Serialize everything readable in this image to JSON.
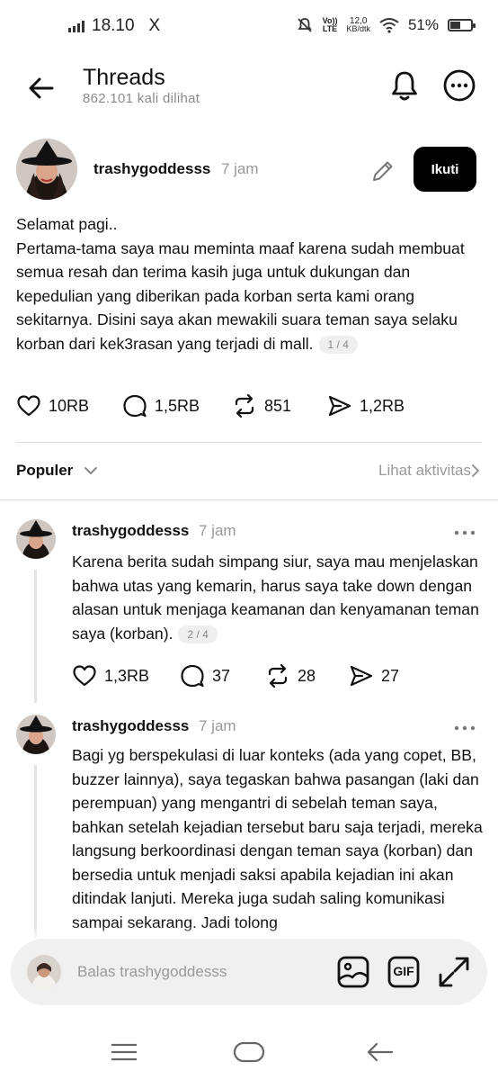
{
  "status_bar": {
    "time": "18.10",
    "x_icon": "X",
    "net_lte": "LTE",
    "net_speed_value": "12,0",
    "net_speed_unit": "KB/dtk",
    "battery": "51%",
    "battery_level": 0.51
  },
  "header": {
    "title": "Threads",
    "subtitle": "862.101 kali dilihat"
  },
  "post": {
    "username": "trashygoddesss",
    "time": "7 jam",
    "follow_label": "Ikuti",
    "text": "Selamat pagi..\nPertama-tama saya mau meminta maaf karena sudah membuat semua resah dan terima kasih juga untuk dukungan dan kepedulian yang diberikan pada korban serta kami orang sekitarnya. Disini saya akan mewakili suara teman saya selaku korban dari kek3rasan yang terjadi di mall.",
    "pager": "1 / 4",
    "likes": "10RB",
    "comments": "1,5RB",
    "reposts": "851",
    "shares": "1,2RB"
  },
  "sort": {
    "label": "Populer",
    "activity_label": "Lihat aktivitas"
  },
  "replies": [
    {
      "username": "trashygoddesss",
      "time": "7 jam",
      "text": "Karena berita sudah simpang siur, saya mau menjelaskan bahwa utas yang kemarin, harus saya take down dengan alasan untuk menjaga keamanan dan kenyamanan teman saya (korban).",
      "pager": "2 / 4",
      "likes": "1,3RB",
      "comments": "37",
      "reposts": "28",
      "shares": "27"
    },
    {
      "username": "trashygoddesss",
      "time": "7 jam",
      "text": "Bagi yg berspekulasi di luar konteks (ada yang copet, BB, buzzer lainnya), saya tegaskan bahwa pasangan (laki dan perempuan) yang mengantri di sebelah teman saya, bahkan setelah kejadian tersebut baru saja terjadi, mereka langsung berkoordinasi dengan teman saya (korban) dan bersedia untuk menjadi saksi apabila kejadian ini akan ditindak lanjuti. Mereka juga sudah saling komunikasi sampai sekarang. Jadi tolong"
    }
  ],
  "reply_bar": {
    "placeholder": "Balas trashygoddesss",
    "gif_label": "GIF"
  },
  "icons": {
    "back": "arrow-left-icon",
    "bell": "bell-icon",
    "more": "more-horizontal-icon",
    "edit": "pencil-icon",
    "like": "heart-icon",
    "comment": "comment-icon",
    "repost": "repost-icon",
    "share": "send-icon",
    "image": "image-icon",
    "gif": "gif-icon",
    "expand": "expand-icon"
  }
}
